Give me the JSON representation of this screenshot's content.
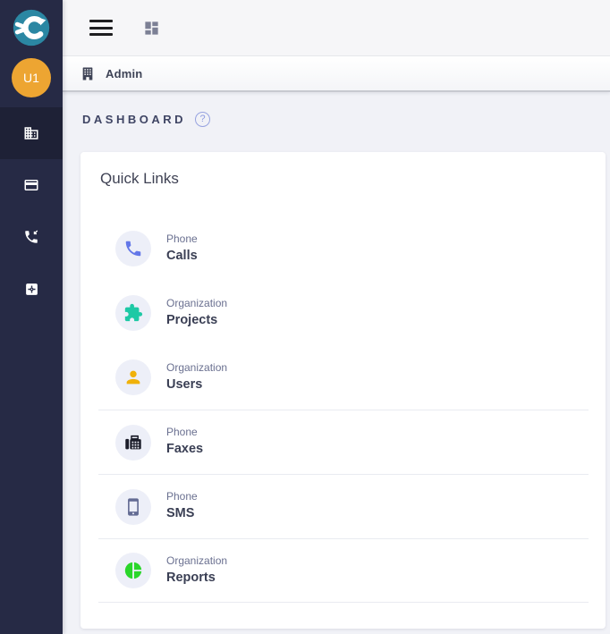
{
  "sidebar": {
    "avatar_text": "U1",
    "items": [
      {
        "icon": "domain-icon"
      },
      {
        "icon": "credit-card-icon"
      },
      {
        "icon": "phone-callback-icon"
      },
      {
        "icon": "settings-box-icon"
      }
    ]
  },
  "topbar": {
    "menu_icon": "hamburger-icon",
    "apps_icon": "dashboard-grid-icon"
  },
  "breadcrumb": {
    "label": "Admin",
    "icon": "building-icon"
  },
  "page": {
    "title": "DASHBOARD",
    "help_label": "?"
  },
  "card": {
    "title": "Quick Links",
    "links": [
      {
        "category": "Phone",
        "label": "Calls",
        "icon": "phone-icon",
        "color": "#6377e8"
      },
      {
        "category": "Organization",
        "label": "Projects",
        "icon": "puzzle-icon",
        "color": "#1ec9a5"
      },
      {
        "category": "Organization",
        "label": "Users",
        "icon": "person-icon",
        "color": "#f0b10a"
      },
      {
        "category": "Phone",
        "label": "Faxes",
        "icon": "fax-icon",
        "color": "#1b1c29"
      },
      {
        "category": "Phone",
        "label": "SMS",
        "icon": "smartphone-icon",
        "color": "#646c94"
      },
      {
        "category": "Organization",
        "label": "Reports",
        "icon": "pie-chart-icon",
        "color": "#2ad62a"
      }
    ]
  },
  "colors": {
    "sidebar_bg": "#262a45",
    "sidebar_active_bg": "#1e2136",
    "logo_teal": "#2b87a3",
    "avatar_orange": "#eda532",
    "content_bg": "#f1f2f7",
    "help_accent": "#8c9ae0",
    "divider": "#e9ebf1"
  }
}
